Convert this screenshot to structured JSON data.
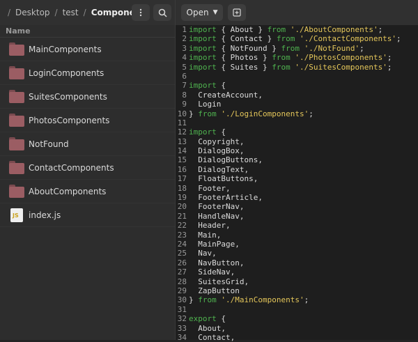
{
  "breadcrumb": {
    "items": [
      "Desktop",
      "test",
      "Components"
    ]
  },
  "header": {
    "menu_icon": "kebab-menu-icon",
    "search_icon": "search-icon"
  },
  "files": {
    "column_header": "Name",
    "items": [
      {
        "name": "MainComponents",
        "type": "folder"
      },
      {
        "name": "LoginComponents",
        "type": "folder"
      },
      {
        "name": "SuitesComponents",
        "type": "folder"
      },
      {
        "name": "PhotosComponents",
        "type": "folder"
      },
      {
        "name": "NotFound",
        "type": "folder"
      },
      {
        "name": "ContactComponents",
        "type": "folder"
      },
      {
        "name": "AboutComponents",
        "type": "folder"
      },
      {
        "name": "index.js",
        "type": "js",
        "icon_label": "JS"
      }
    ]
  },
  "editor": {
    "open_label": "Open",
    "line_numbers": [
      "1",
      "2",
      "3",
      "4",
      "5",
      "6",
      "7",
      "8",
      "9",
      "10",
      "11",
      "12",
      "13",
      "14",
      "15",
      "16",
      "17",
      "18",
      "19",
      "20",
      "21",
      "22",
      "23",
      "24",
      "25",
      "26",
      "27",
      "28",
      "29",
      "30",
      "31",
      "32",
      "33",
      "34"
    ],
    "lines": [
      [
        {
          "t": "kw",
          "v": "import"
        },
        {
          "t": "txt",
          "v": " { About } "
        },
        {
          "t": "kw",
          "v": "from"
        },
        {
          "t": "txt",
          "v": " "
        },
        {
          "t": "str",
          "v": "'./AboutComponents'"
        },
        {
          "t": "txt",
          "v": ";"
        }
      ],
      [
        {
          "t": "kw",
          "v": "import"
        },
        {
          "t": "txt",
          "v": " { Contact } "
        },
        {
          "t": "kw",
          "v": "from"
        },
        {
          "t": "txt",
          "v": " "
        },
        {
          "t": "str",
          "v": "'./ContactComponents'"
        },
        {
          "t": "txt",
          "v": ";"
        }
      ],
      [
        {
          "t": "kw",
          "v": "import"
        },
        {
          "t": "txt",
          "v": " { NotFound } "
        },
        {
          "t": "kw",
          "v": "from"
        },
        {
          "t": "txt",
          "v": " "
        },
        {
          "t": "str",
          "v": "'./NotFound'"
        },
        {
          "t": "txt",
          "v": ";"
        }
      ],
      [
        {
          "t": "kw",
          "v": "import"
        },
        {
          "t": "txt",
          "v": " { Photos } "
        },
        {
          "t": "kw",
          "v": "from"
        },
        {
          "t": "txt",
          "v": " "
        },
        {
          "t": "str",
          "v": "'./PhotosComponents'"
        },
        {
          "t": "txt",
          "v": ";"
        }
      ],
      [
        {
          "t": "kw",
          "v": "import"
        },
        {
          "t": "txt",
          "v": " { Suites } "
        },
        {
          "t": "kw",
          "v": "from"
        },
        {
          "t": "txt",
          "v": " "
        },
        {
          "t": "str",
          "v": "'./SuitesComponents'"
        },
        {
          "t": "txt",
          "v": ";"
        }
      ],
      [],
      [
        {
          "t": "kw",
          "v": "import"
        },
        {
          "t": "txt",
          "v": " {"
        }
      ],
      [
        {
          "t": "txt",
          "v": "  CreateAccount,"
        }
      ],
      [
        {
          "t": "txt",
          "v": "  Login"
        }
      ],
      [
        {
          "t": "txt",
          "v": "} "
        },
        {
          "t": "kw",
          "v": "from"
        },
        {
          "t": "txt",
          "v": " "
        },
        {
          "t": "str",
          "v": "'./LoginComponents'"
        },
        {
          "t": "txt",
          "v": ";"
        }
      ],
      [],
      [
        {
          "t": "kw",
          "v": "import"
        },
        {
          "t": "txt",
          "v": " {"
        }
      ],
      [
        {
          "t": "txt",
          "v": "  Copyright,"
        }
      ],
      [
        {
          "t": "txt",
          "v": "  DialogBox,"
        }
      ],
      [
        {
          "t": "txt",
          "v": "  DialogButtons,"
        }
      ],
      [
        {
          "t": "txt",
          "v": "  DialogText,"
        }
      ],
      [
        {
          "t": "txt",
          "v": "  FloatButtons,"
        }
      ],
      [
        {
          "t": "txt",
          "v": "  Footer,"
        }
      ],
      [
        {
          "t": "txt",
          "v": "  FooterArticle,"
        }
      ],
      [
        {
          "t": "txt",
          "v": "  FooterNav,"
        }
      ],
      [
        {
          "t": "txt",
          "v": "  HandleNav,"
        }
      ],
      [
        {
          "t": "txt",
          "v": "  Header,"
        }
      ],
      [
        {
          "t": "txt",
          "v": "  Main,"
        }
      ],
      [
        {
          "t": "txt",
          "v": "  MainPage,"
        }
      ],
      [
        {
          "t": "txt",
          "v": "  Nav,"
        }
      ],
      [
        {
          "t": "txt",
          "v": "  NavButton,"
        }
      ],
      [
        {
          "t": "txt",
          "v": "  SideNav,"
        }
      ],
      [
        {
          "t": "txt",
          "v": "  SuitesGrid,"
        }
      ],
      [
        {
          "t": "txt",
          "v": "  ZapButton"
        }
      ],
      [
        {
          "t": "txt",
          "v": "} "
        },
        {
          "t": "kw",
          "v": "from"
        },
        {
          "t": "txt",
          "v": " "
        },
        {
          "t": "str",
          "v": "'./MainComponents'"
        },
        {
          "t": "txt",
          "v": ";"
        }
      ],
      [],
      [
        {
          "t": "kw",
          "v": "export"
        },
        {
          "t": "txt",
          "v": " {"
        }
      ],
      [
        {
          "t": "txt",
          "v": "  About,"
        }
      ],
      [
        {
          "t": "txt",
          "v": "  Contact,"
        }
      ]
    ]
  }
}
